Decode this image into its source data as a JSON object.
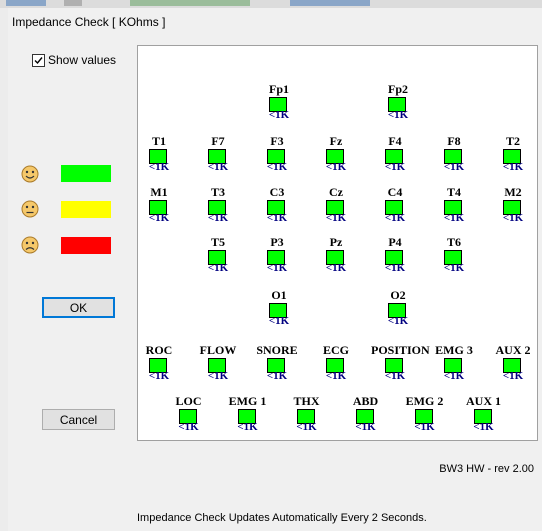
{
  "window": {
    "title": "Impedance Check [ KOhms ]"
  },
  "show_values": {
    "label": "Show values",
    "checked": true
  },
  "legend": [
    {
      "icon": "happy-face-icon",
      "color": "#00ff00"
    },
    {
      "icon": "neutral-face-icon",
      "color": "#ffff00"
    },
    {
      "icon": "sad-face-icon",
      "color": "#ff0000"
    }
  ],
  "buttons": {
    "ok": "OK",
    "cancel": "Cancel"
  },
  "electrodes": [
    {
      "name": "Fp1",
      "value": "<1K",
      "color": "#00ff00"
    },
    {
      "name": "Fp2",
      "value": "<1K",
      "color": "#00ff00"
    },
    {
      "name": "T1",
      "value": "<1K",
      "color": "#00ff00"
    },
    {
      "name": "F7",
      "value": "<1K",
      "color": "#00ff00"
    },
    {
      "name": "F3",
      "value": "<1K",
      "color": "#00ff00"
    },
    {
      "name": "Fz",
      "value": "<1K",
      "color": "#00ff00"
    },
    {
      "name": "F4",
      "value": "<1K",
      "color": "#00ff00"
    },
    {
      "name": "F8",
      "value": "<1K",
      "color": "#00ff00"
    },
    {
      "name": "T2",
      "value": "<1K",
      "color": "#00ff00"
    },
    {
      "name": "M1",
      "value": "<1K",
      "color": "#00ff00"
    },
    {
      "name": "T3",
      "value": "<1K",
      "color": "#00ff00"
    },
    {
      "name": "C3",
      "value": "<1K",
      "color": "#00ff00"
    },
    {
      "name": "Cz",
      "value": "<1K",
      "color": "#00ff00"
    },
    {
      "name": "C4",
      "value": "<1K",
      "color": "#00ff00"
    },
    {
      "name": "T4",
      "value": "<1K",
      "color": "#00ff00"
    },
    {
      "name": "M2",
      "value": "<1K",
      "color": "#00ff00"
    },
    {
      "name": "T5",
      "value": "<1K",
      "color": "#00ff00"
    },
    {
      "name": "P3",
      "value": "<1K",
      "color": "#00ff00"
    },
    {
      "name": "Pz",
      "value": "<1K",
      "color": "#00ff00"
    },
    {
      "name": "P4",
      "value": "<1K",
      "color": "#00ff00"
    },
    {
      "name": "T6",
      "value": "<1K",
      "color": "#00ff00"
    },
    {
      "name": "O1",
      "value": "<1K",
      "color": "#00ff00"
    },
    {
      "name": "O2",
      "value": "<1K",
      "color": "#00ff00"
    },
    {
      "name": "ROC",
      "value": "<1K",
      "color": "#00ff00"
    },
    {
      "name": "FLOW",
      "value": "<1K",
      "color": "#00ff00"
    },
    {
      "name": "SNORE",
      "value": "<1K",
      "color": "#00ff00"
    },
    {
      "name": "ECG",
      "value": "<1K",
      "color": "#00ff00"
    },
    {
      "name": "POSITION",
      "value": "<1K",
      "color": "#00ff00"
    },
    {
      "name": "EMG 3",
      "value": "<1K",
      "color": "#00ff00"
    },
    {
      "name": "AUX 2",
      "value": "<1K",
      "color": "#00ff00"
    },
    {
      "name": "LOC",
      "value": "<1K",
      "color": "#00ff00"
    },
    {
      "name": "EMG 1",
      "value": "<1K",
      "color": "#00ff00"
    },
    {
      "name": "THX",
      "value": "<1K",
      "color": "#00ff00"
    },
    {
      "name": "ABD",
      "value": "<1K",
      "color": "#00ff00"
    },
    {
      "name": "EMG 2",
      "value": "<1K",
      "color": "#00ff00"
    },
    {
      "name": "AUX 1",
      "value": "<1K",
      "color": "#00ff00"
    }
  ],
  "hardware_rev": "BW3 HW - rev 2.00",
  "footer": "Impedance Check Updates Automatically Every 2 Seconds."
}
